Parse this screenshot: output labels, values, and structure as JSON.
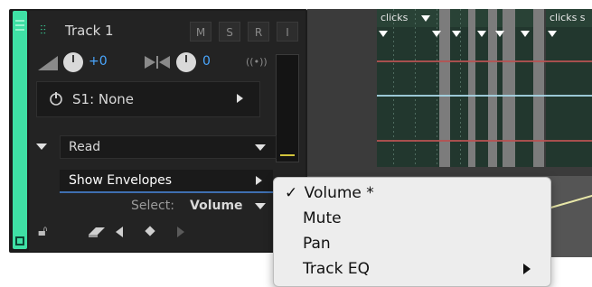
{
  "track": {
    "name": "Track 1",
    "buttons": [
      "M",
      "S",
      "R",
      "I"
    ],
    "volume_value": "+0",
    "pan_value": "0",
    "input_slot": "S1: None",
    "automation_mode": "Read",
    "show_envelopes_label": "Show Envelopes",
    "select_label": "Select:",
    "select_value": "Volume"
  },
  "timeline": {
    "clips": [
      "clicks",
      "clicks s"
    ]
  },
  "context_menu": {
    "items": [
      {
        "label": "Volume *",
        "checked": true,
        "check_mark": "✓"
      },
      {
        "label": "Mute"
      },
      {
        "label": "Pan"
      },
      {
        "label": "Track EQ",
        "has_submenu": true
      }
    ]
  },
  "colors": {
    "track_accent": "#3fe0a5",
    "menu_background": "#ededed",
    "clip_background": "#22372e",
    "envelope_red": "#b65252",
    "envelope_blue": "#a9d7e8"
  },
  "icons": [
    "waveform-icon",
    "volume-icon",
    "pan-icon",
    "input-monitor-icon",
    "power-icon",
    "chevron-right-icon",
    "chevron-down-icon",
    "eraser-icon",
    "previous-keyframe-icon",
    "add-keyframe-icon",
    "next-keyframe-icon",
    "lock-icon",
    "checkmark-icon"
  ]
}
